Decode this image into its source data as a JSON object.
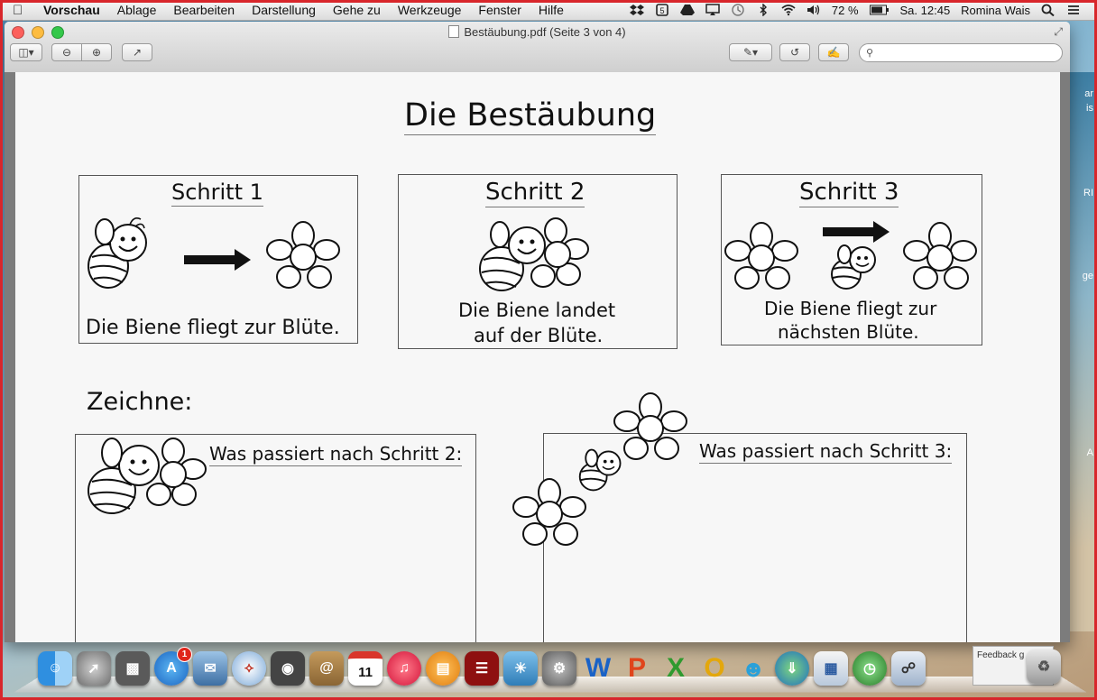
{
  "menubar": {
    "app_name": "Vorschau",
    "items": [
      "Ablage",
      "Bearbeiten",
      "Darstellung",
      "Gehe zu",
      "Werkzeuge",
      "Fenster",
      "Hilfe"
    ],
    "battery": "72 %",
    "clock": "Sa. 12:45",
    "user": "Romina Wais"
  },
  "window": {
    "title": "Bestäubung.pdf (Seite 3 von 4)"
  },
  "document": {
    "title": "Die Bestäubung",
    "step1": {
      "heading": "Schritt 1",
      "caption": "Die Biene fliegt zur Blüte."
    },
    "step2": {
      "heading": "Schritt 2",
      "caption_line1": "Die Biene landet",
      "caption_line2": "auf der Blüte."
    },
    "step3": {
      "heading": "Schritt 3",
      "caption_line1": "Die Biene fliegt zur",
      "caption_line2": "nächsten Blüte."
    },
    "draw_label": "Zeichne:",
    "box_left_label": "Was passiert nach Schritt 2:",
    "box_right_label": "Was passiert nach Schritt 3:"
  },
  "desktop": {
    "right_edge_labels": [
      "ar",
      "is",
      "RI",
      "ge",
      "A"
    ]
  },
  "dock": {
    "appstore_badge": "1",
    "calendar_day": "11",
    "feedback_label": "Feedback g",
    "apps": [
      "finder",
      "launchpad",
      "photo-booth",
      "app-store",
      "mail-stamp",
      "safari",
      "facetime",
      "address-book",
      "calendar",
      "itunes",
      "ibooks",
      "photo-booth-curtain",
      "iphoto",
      "system-preferences",
      "word",
      "powerpoint",
      "excel",
      "outlook",
      "messenger",
      "network",
      "remote-desktop",
      "time-machine",
      "preview",
      "feedback",
      "trash"
    ]
  }
}
